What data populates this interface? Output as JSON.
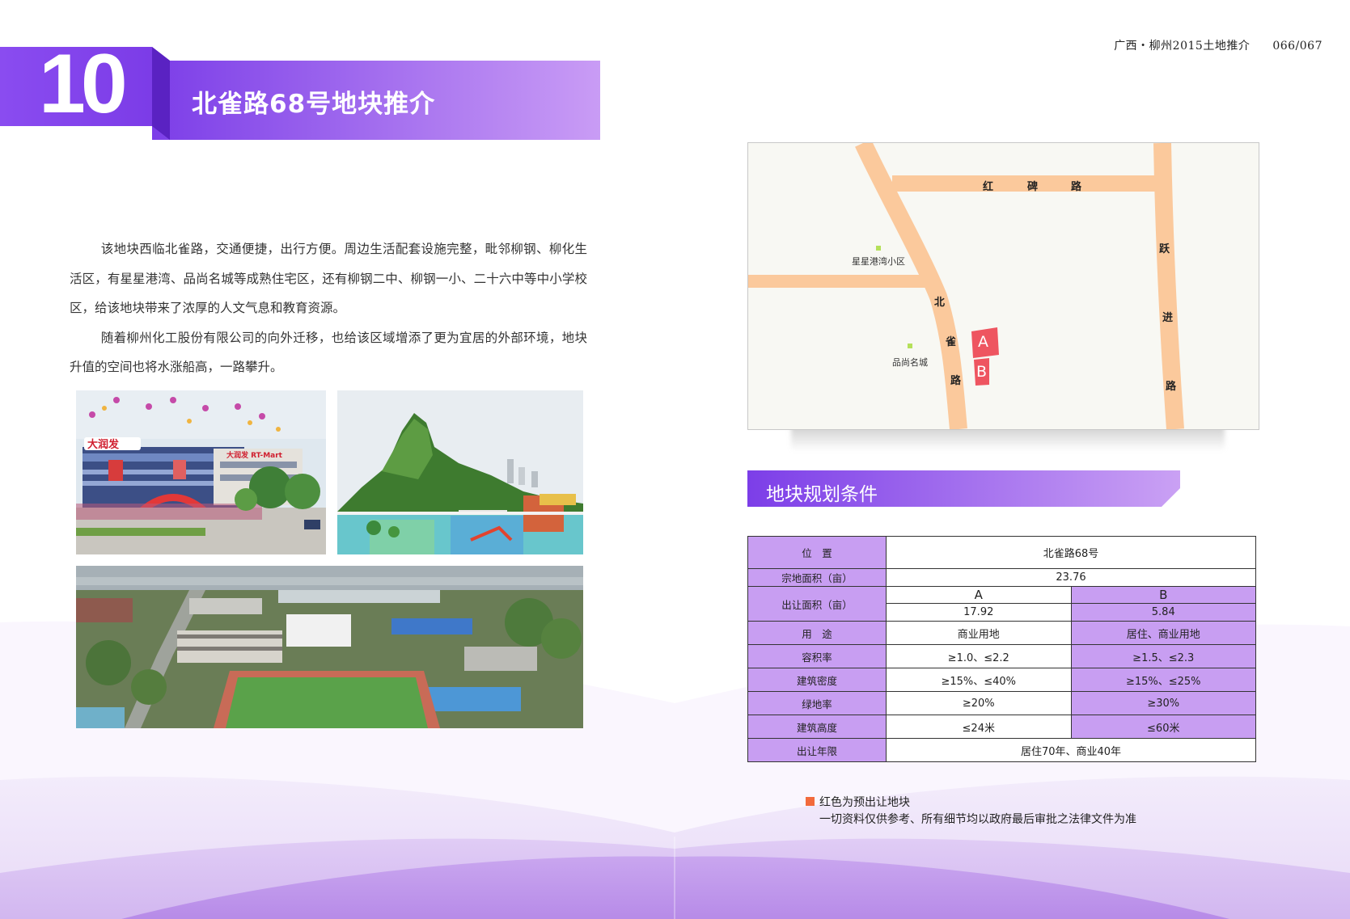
{
  "header": {
    "doc_title": "广西・柳州2015土地推介",
    "page_numbers": "066/067"
  },
  "banner": {
    "chapter_number": "10",
    "title": "北雀路68号地块推介"
  },
  "intro": {
    "paragraph_1": "该地块西临北雀路，交通便捷，出行方便。周边生活配套设施完整，毗邻柳钢、柳化生活区，有星星港湾、品尚名城等成熟住宅区，还有柳钢二中、柳钢一小、二十六中等中小学校区，给该地块带来了浓厚的人文气息和教育资源。",
    "paragraph_2": "随着柳州化工股份有限公司的向外迁移，也给该区域增添了更为宜居的外部环境，地块升值的空间也将水涨船高，一路攀升。"
  },
  "photos": {
    "photo_1_sign_main": "大润发",
    "photo_1_sign_secondary": "大润发 RT-Mart"
  },
  "map": {
    "road_hongbei": [
      "红",
      "碑",
      "路"
    ],
    "road_beique": [
      "北",
      "雀",
      "路"
    ],
    "road_yuejin": [
      "跃",
      "进",
      "路"
    ],
    "poi_1": "星星港湾小区",
    "poi_2": "品尚名城",
    "plot_a": "A",
    "plot_b": "B"
  },
  "planning": {
    "section_title": "地块规划条件",
    "rows": {
      "location_label": "位　置",
      "location_value": "北雀路68号",
      "total_area_label": "宗地面积（亩）",
      "total_area_value": "23.76",
      "transfer_area_label": "出让面积（亩）",
      "plot_a_header": "A",
      "plot_b_header": "B",
      "area_a": "17.92",
      "area_b": "5.84",
      "usage_label": "用　途",
      "usage_a": "商业用地",
      "usage_b": "居住、商业用地",
      "far_label": "容积率",
      "far_a": "≥1.0、≤2.2",
      "far_b": "≥1.5、≤2.3",
      "density_label": "建筑密度",
      "density_a": "≥15%、≤40%",
      "density_b": "≥15%、≤25%",
      "green_label": "绿地率",
      "green_a": "≥20%",
      "green_b": "≥30%",
      "height_label": "建筑高度",
      "height_a": "≤24米",
      "height_b": "≤60米",
      "term_label": "出让年限",
      "term_value": "居住70年、商业40年"
    }
  },
  "notes": {
    "legend": "红色为预出让地块",
    "disclaimer": "一切资料仅供参考、所有细节均以政府最后审批之法律文件为准"
  },
  "colors": {
    "purple_dark": "#7c3ee8",
    "purple_light": "#c99cf5",
    "table_label_bg": "#c89ef2",
    "road": "#fbc99c",
    "plot_red": "#ee5560",
    "legend_orange": "#f26a3c"
  }
}
